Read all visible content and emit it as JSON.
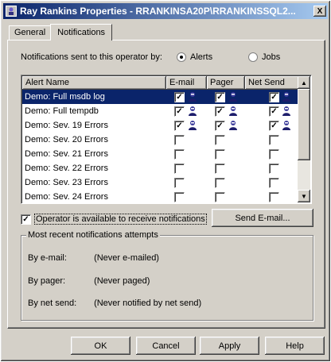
{
  "window": {
    "title": "Ray Rankins Properties - RRANKINSA20P\\RRANKINSSQL2...",
    "close_glyph": "X"
  },
  "tabs": [
    {
      "label": "General"
    },
    {
      "label": "Notifications"
    }
  ],
  "notify_by": {
    "label": "Notifications sent to this operator by:",
    "options": [
      {
        "label": "Alerts",
        "selected": true
      },
      {
        "label": "Jobs",
        "selected": false
      }
    ]
  },
  "list": {
    "columns": [
      "Alert Name",
      "E-mail",
      "Pager",
      "Net Send"
    ],
    "rows": [
      {
        "name": "Demo: Full msdb log",
        "email": true,
        "pager": true,
        "netsend": true,
        "selected": true
      },
      {
        "name": "Demo: Full tempdb",
        "email": true,
        "pager": true,
        "netsend": true,
        "selected": false
      },
      {
        "name": "Demo: Sev. 19 Errors",
        "email": true,
        "pager": true,
        "netsend": true,
        "selected": false
      },
      {
        "name": "Demo: Sev. 20 Errors",
        "email": false,
        "pager": false,
        "netsend": false,
        "selected": false
      },
      {
        "name": "Demo: Sev. 21 Errors",
        "email": false,
        "pager": false,
        "netsend": false,
        "selected": false
      },
      {
        "name": "Demo: Sev. 22 Errors",
        "email": false,
        "pager": false,
        "netsend": false,
        "selected": false
      },
      {
        "name": "Demo: Sev. 23 Errors",
        "email": false,
        "pager": false,
        "netsend": false,
        "selected": false
      },
      {
        "name": "Demo: Sev. 24 Errors",
        "email": false,
        "pager": false,
        "netsend": false,
        "selected": false
      }
    ]
  },
  "available": {
    "label": "Operator is available to receive notifications",
    "checked": true
  },
  "send_email_button": "Send E-mail...",
  "recent": {
    "title": "Most recent notifications attempts",
    "items": [
      {
        "label": "By e-mail:",
        "value": "(Never e-mailed)"
      },
      {
        "label": "By pager:",
        "value": "(Never paged)"
      },
      {
        "label": "By net send:",
        "value": "(Never notified by net send)"
      }
    ]
  },
  "footer": {
    "ok": "OK",
    "cancel": "Cancel",
    "apply": "Apply",
    "help": "Help"
  },
  "colors": {
    "selection": "#0a246a",
    "face": "#d4d0c8"
  },
  "icons": {
    "operator": "operator-icon",
    "check": "checkmark-icon"
  }
}
